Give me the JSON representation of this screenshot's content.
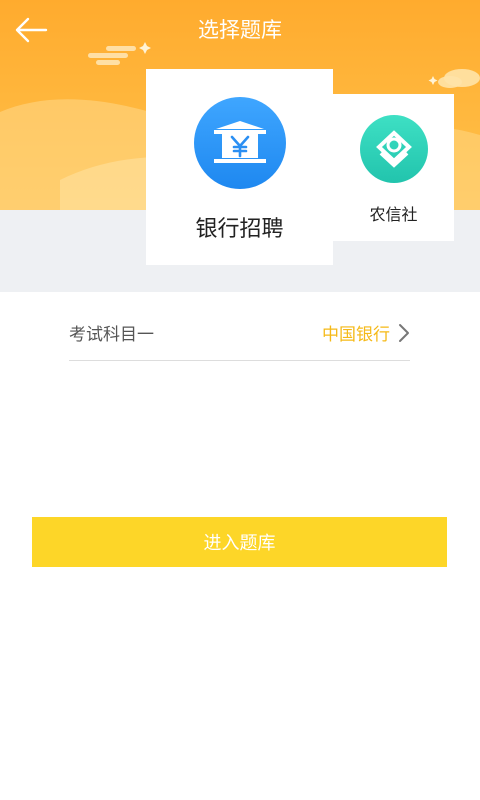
{
  "header": {
    "title": "选择题库",
    "back_icon": "arrow-left-icon"
  },
  "categories": [
    {
      "label": "银行招聘",
      "icon": "bank-yuan-icon",
      "selected": true,
      "color": "#2a93f5"
    },
    {
      "label": "农信社",
      "icon": "rural-credit-logo-icon",
      "selected": false,
      "color": "#2fd3b8"
    }
  ],
  "subject": {
    "label": "考试科目一",
    "value": "中国银行",
    "value_color": "#f5b917"
  },
  "enter_button": {
    "label": "进入题库",
    "color": "#fdd628"
  },
  "theme": {
    "header_color": "#ffab2e"
  }
}
